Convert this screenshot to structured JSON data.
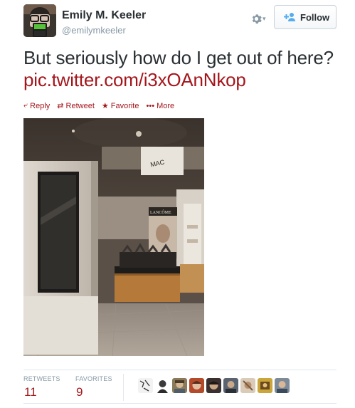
{
  "user": {
    "name": "Emily M. Keeler",
    "handle": "@emilymkeeler"
  },
  "header": {
    "follow_label": "Follow",
    "gear_icon": "gear-icon"
  },
  "tweet": {
    "text": "But seriously how do I get out of here?",
    "link": "pic.twitter.com/i3xOAnNkop"
  },
  "actions": {
    "reply": "Reply",
    "retweet": "Retweet",
    "favorite": "Favorite",
    "more": "More"
  },
  "media": {
    "sign_text": "MAC",
    "store_sign": "LANCÔME"
  },
  "stats": {
    "retweets_label": "RETWEETS",
    "retweets_count": "11",
    "favorites_label": "FAVORITES",
    "favorites_count": "9"
  },
  "colors": {
    "accent": "#a4161c",
    "muted": "#8899a6",
    "text": "#292f33"
  }
}
